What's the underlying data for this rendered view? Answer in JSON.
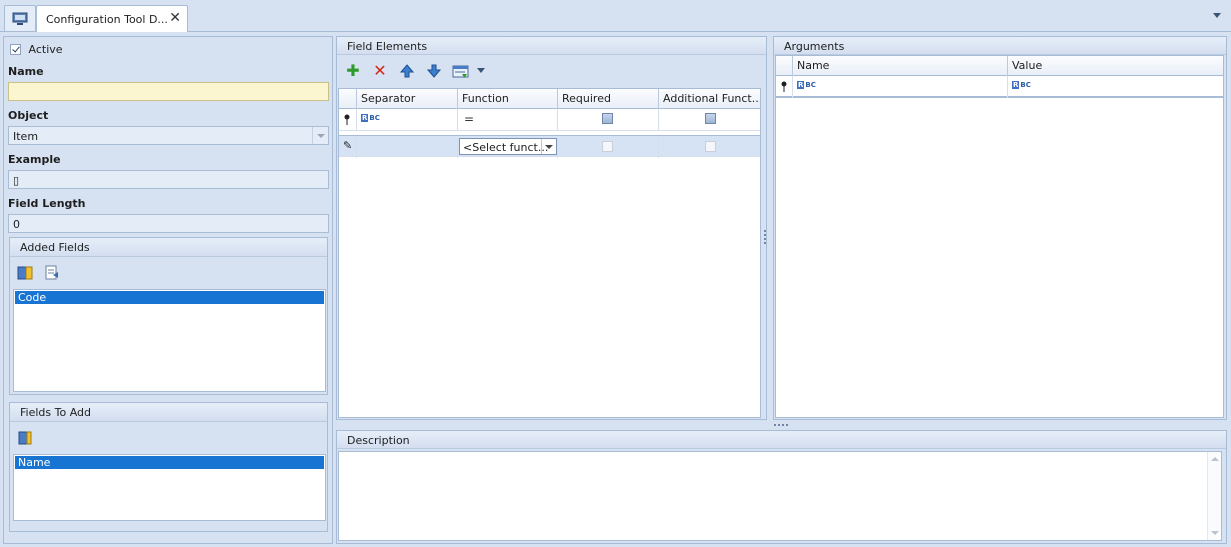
{
  "tabs": {
    "home_icon": "monitor-icon",
    "doc_title": "Configuration Tool D...",
    "close_glyph": "✕"
  },
  "left": {
    "active_label": "Active",
    "active_checked": true,
    "name_label": "Name",
    "name_value": "",
    "object_label": "Object",
    "object_value": "Item",
    "example_label": "Example",
    "example_value": "▯",
    "field_length_label": "Field Length",
    "field_length_value": "0",
    "added_fields": {
      "title": "Added Fields",
      "items": [
        "Code"
      ]
    },
    "fields_to_add": {
      "title": "Fields To Add",
      "items": [
        "Name"
      ]
    }
  },
  "field_elements": {
    "title": "Field Elements",
    "toolbar": [
      "add-icon",
      "delete-icon",
      "move-up-icon",
      "move-down-icon",
      "view-options-icon"
    ],
    "columns": [
      "Separator",
      "Function",
      "Required",
      "Additional Funct..."
    ],
    "filter_row": {
      "separator": "RBC",
      "function": "="
    },
    "new_row": {
      "function_placeholder": "<Select funct..."
    }
  },
  "arguments": {
    "title": "Arguments",
    "columns": [
      "Name",
      "Value"
    ],
    "filter_row": {
      "name": "RBC",
      "value": "RBC"
    }
  },
  "description": {
    "title": "Description",
    "value": ""
  },
  "colors": {
    "background": "#d6e2f1",
    "selection": "#1874d2",
    "required_field": "#fbf6cf"
  }
}
